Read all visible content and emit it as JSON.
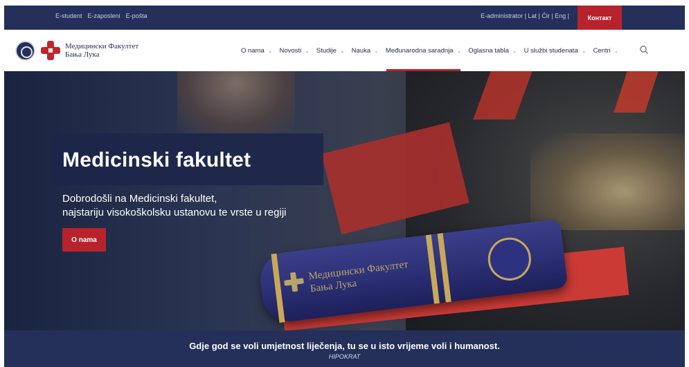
{
  "topbar": {
    "links": [
      "E-student",
      "E-zaposleni",
      "E-pošta"
    ],
    "right_text": "E-administrator | Lat | Ćir | Eng |",
    "contact_label": "Контакт"
  },
  "logo": {
    "line1": "Медицински Факултет",
    "line2": "Бања Лука"
  },
  "nav": {
    "items": [
      {
        "label": "O nama"
      },
      {
        "label": "Novosti"
      },
      {
        "label": "Studije"
      },
      {
        "label": "Nauka"
      },
      {
        "label": "Međunarodna saradnja"
      },
      {
        "label": "Oglasna tabla"
      },
      {
        "label": "U službi studenata"
      },
      {
        "label": "Centri"
      }
    ],
    "active_index": 4
  },
  "hero": {
    "title": "Medicinski fakultet",
    "subtitle_line1": "Dobrodošli na Medicinski fakultet,",
    "subtitle_line2": "najstariju visokoškolsku ustanovu te vrste u regiji",
    "cta_label": "O nama",
    "book_line1": "Медицински Факултет",
    "book_line2": "Бања Лука"
  },
  "quote": {
    "text": "Gdje god se voli umjetnost liječenja, tu se u isto vrijeme voli i humanost.",
    "author": "HIPOKRAT"
  },
  "colors": {
    "navy": "#24305a",
    "accent_red": "#b8222c"
  }
}
